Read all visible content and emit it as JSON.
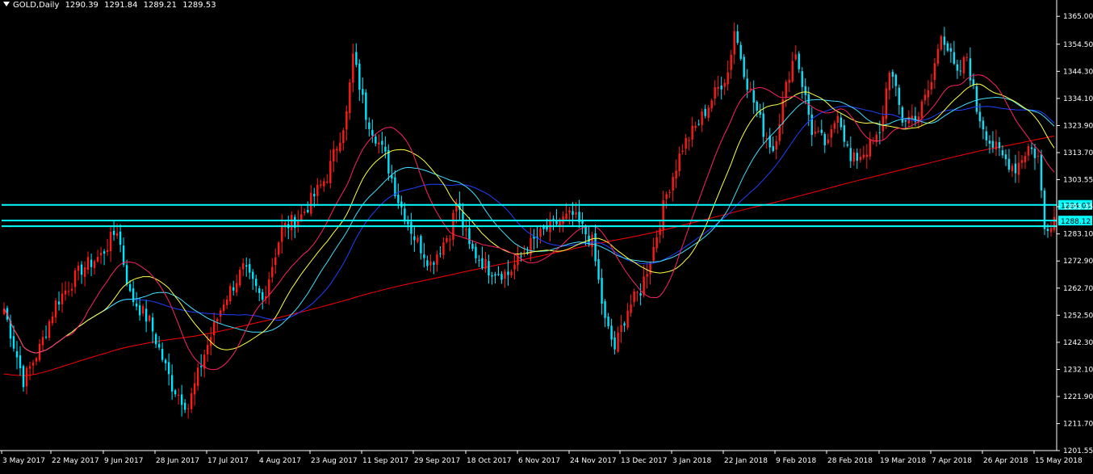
{
  "header": {
    "symbol": "GOLD,Daily",
    "open": "1290.39",
    "high": "1291.84",
    "low": "1289.21",
    "close": "1289.53"
  },
  "colors": {
    "background": "#000000",
    "axis": "#ffffff",
    "bull_candle": "#ff1a1a",
    "bear_candle": "#00e5ff",
    "hline": "#00ffff",
    "ma_red_long": "#ff0000",
    "ma_blue": "#1f3fff",
    "ma_cyan": "#40e0ff",
    "ma_yellow": "#ffff40",
    "ma_crimson": "#ff2060"
  },
  "chart_data": {
    "type": "candlestick",
    "ylim": [
      1201.55,
      1367.5
    ],
    "y_ticks": [
      "1365.00",
      "1354.50",
      "1344.30",
      "1334.10",
      "1323.90",
      "1313.70",
      "1303.55",
      "1293.35",
      "1283.10",
      "1272.90",
      "1262.70",
      "1252.50",
      "1242.30",
      "1232.10",
      "1221.90",
      "1211.70",
      "1201.55"
    ],
    "x_ticks": [
      "3 May 2017",
      "22 May 2017",
      "9 Jun 2017",
      "28 Jun 2017",
      "17 Jul 2017",
      "4 Aug 2017",
      "23 Aug 2017",
      "11 Sep 2017",
      "29 Sep 2017",
      "18 Oct 2017",
      "6 Nov 2017",
      "24 Nov 2017",
      "13 Dec 2017",
      "3 Jan 2018",
      "22 Jan 2018",
      "9 Feb 2018",
      "28 Feb 2018",
      "19 Mar 2018",
      "7 Apr 2018",
      "26 Apr 2018",
      "15 May 2018"
    ],
    "horizontal_lines": [
      {
        "value": 1294.03,
        "label": "1294.03"
      },
      {
        "value": 1288.12,
        "label": "1288.12"
      },
      {
        "value": 1286.0,
        "label": ""
      }
    ],
    "close_anchors": [
      [
        0,
        1255
      ],
      [
        6,
        1228
      ],
      [
        11,
        1240
      ],
      [
        16,
        1257
      ],
      [
        24,
        1270
      ],
      [
        30,
        1275
      ],
      [
        35,
        1285
      ],
      [
        39,
        1260
      ],
      [
        45,
        1250
      ],
      [
        52,
        1226
      ],
      [
        57,
        1218
      ],
      [
        62,
        1238
      ],
      [
        68,
        1258
      ],
      [
        74,
        1270
      ],
      [
        80,
        1258
      ],
      [
        86,
        1285
      ],
      [
        92,
        1290
      ],
      [
        100,
        1305
      ],
      [
        106,
        1328
      ],
      [
        108,
        1350
      ],
      [
        112,
        1328
      ],
      [
        118,
        1312
      ],
      [
        122,
        1296
      ],
      [
        127,
        1282
      ],
      [
        132,
        1272
      ],
      [
        138,
        1284
      ],
      [
        140,
        1295
      ],
      [
        144,
        1278
      ],
      [
        150,
        1270
      ],
      [
        156,
        1268
      ],
      [
        162,
        1278
      ],
      [
        168,
        1285
      ],
      [
        172,
        1288
      ],
      [
        176,
        1290
      ],
      [
        182,
        1280
      ],
      [
        186,
        1250
      ],
      [
        189,
        1240
      ],
      [
        193,
        1255
      ],
      [
        197,
        1262
      ],
      [
        201,
        1278
      ],
      [
        205,
        1298
      ],
      [
        210,
        1316
      ],
      [
        215,
        1325
      ],
      [
        220,
        1336
      ],
      [
        224,
        1344
      ],
      [
        226,
        1360
      ],
      [
        230,
        1340
      ],
      [
        235,
        1322
      ],
      [
        238,
        1315
      ],
      [
        243,
        1344
      ],
      [
        245,
        1352
      ],
      [
        250,
        1322
      ],
      [
        255,
        1316
      ],
      [
        258,
        1330
      ],
      [
        262,
        1310
      ],
      [
        267,
        1315
      ],
      [
        271,
        1320
      ],
      [
        274,
        1346
      ],
      [
        278,
        1326
      ],
      [
        283,
        1328
      ],
      [
        287,
        1340
      ],
      [
        290,
        1360
      ],
      [
        295,
        1342
      ],
      [
        298,
        1350
      ],
      [
        301,
        1330
      ],
      [
        305,
        1318
      ],
      [
        309,
        1312
      ],
      [
        313,
        1308
      ],
      [
        317,
        1316
      ],
      [
        320,
        1312
      ],
      [
        322,
        1285
      ],
      [
        325,
        1290
      ]
    ],
    "moving_averages": [
      {
        "periods": 200,
        "color": "#ff0000"
      },
      {
        "periods": 50,
        "color": "#1f3fff"
      },
      {
        "periods": 40,
        "color": "#40e0ff"
      },
      {
        "periods": 30,
        "color": "#ffff40"
      },
      {
        "periods": 20,
        "color": "#ff2060"
      }
    ],
    "current_price": 1289.53,
    "bar_count": 326
  }
}
